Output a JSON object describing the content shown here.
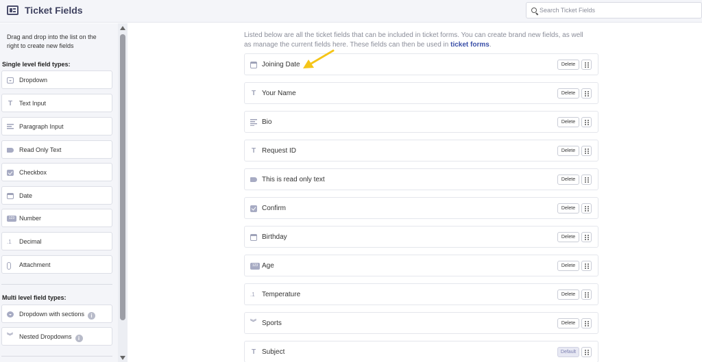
{
  "header": {
    "title": "Ticket Fields",
    "search_placeholder": "Search Ticket Fields"
  },
  "sidebar": {
    "hint": "Drag and drop into the list on the right to create new fields",
    "single_label": "Single level field types:",
    "single_items": [
      {
        "label": "Dropdown",
        "icon": "dropdown-icon"
      },
      {
        "label": "Text Input",
        "icon": "text-icon"
      },
      {
        "label": "Paragraph Input",
        "icon": "paragraph-icon"
      },
      {
        "label": "Read Only Text",
        "icon": "tag-icon"
      },
      {
        "label": "Checkbox",
        "icon": "checkbox-icon"
      },
      {
        "label": "Date",
        "icon": "calendar-icon"
      },
      {
        "label": "Number",
        "icon": "number-icon"
      },
      {
        "label": "Decimal",
        "icon": "decimal-icon"
      },
      {
        "label": "Attachment",
        "icon": "paperclip-icon"
      }
    ],
    "multi_label": "Multi level field types:",
    "multi_items": [
      {
        "label": "Dropdown with sections",
        "icon": "dropdown-sections-icon"
      },
      {
        "label": "Nested Dropdowns",
        "icon": "nested-dropdown-icon"
      }
    ]
  },
  "main": {
    "intro_text": "Listed below are all the ticket fields that can be included in ticket forms. You can create brand new fields, as well as manage the current fields here. These fields can then be used in",
    "intro_link": "ticket forms",
    "intro_end": ".",
    "delete_label": "Delete",
    "default_label": "Default",
    "fields": [
      {
        "label": "Joining Date",
        "icon": "calendar-icon"
      },
      {
        "label": "Your Name",
        "icon": "text-icon"
      },
      {
        "label": "Bio",
        "icon": "paragraph-icon"
      },
      {
        "label": "Request ID",
        "icon": "text-icon"
      },
      {
        "label": "This is read only text",
        "icon": "tag-icon"
      },
      {
        "label": "Confirm",
        "icon": "checkbox-icon"
      },
      {
        "label": "Birthday",
        "icon": "calendar-icon"
      },
      {
        "label": "Age",
        "icon": "number-icon"
      },
      {
        "label": "Temperature",
        "icon": "decimal-icon"
      },
      {
        "label": "Sports",
        "icon": "nested-dropdown-icon"
      },
      {
        "label": "Subject",
        "icon": "text-icon"
      }
    ]
  },
  "icons": {
    "number_glyph": "123",
    "decimal_glyph": ".1",
    "text_glyph": "T",
    "info_glyph": "i"
  },
  "colors": {
    "accent": "#3a4fa8",
    "annotation_arrow": "#f5c518"
  }
}
